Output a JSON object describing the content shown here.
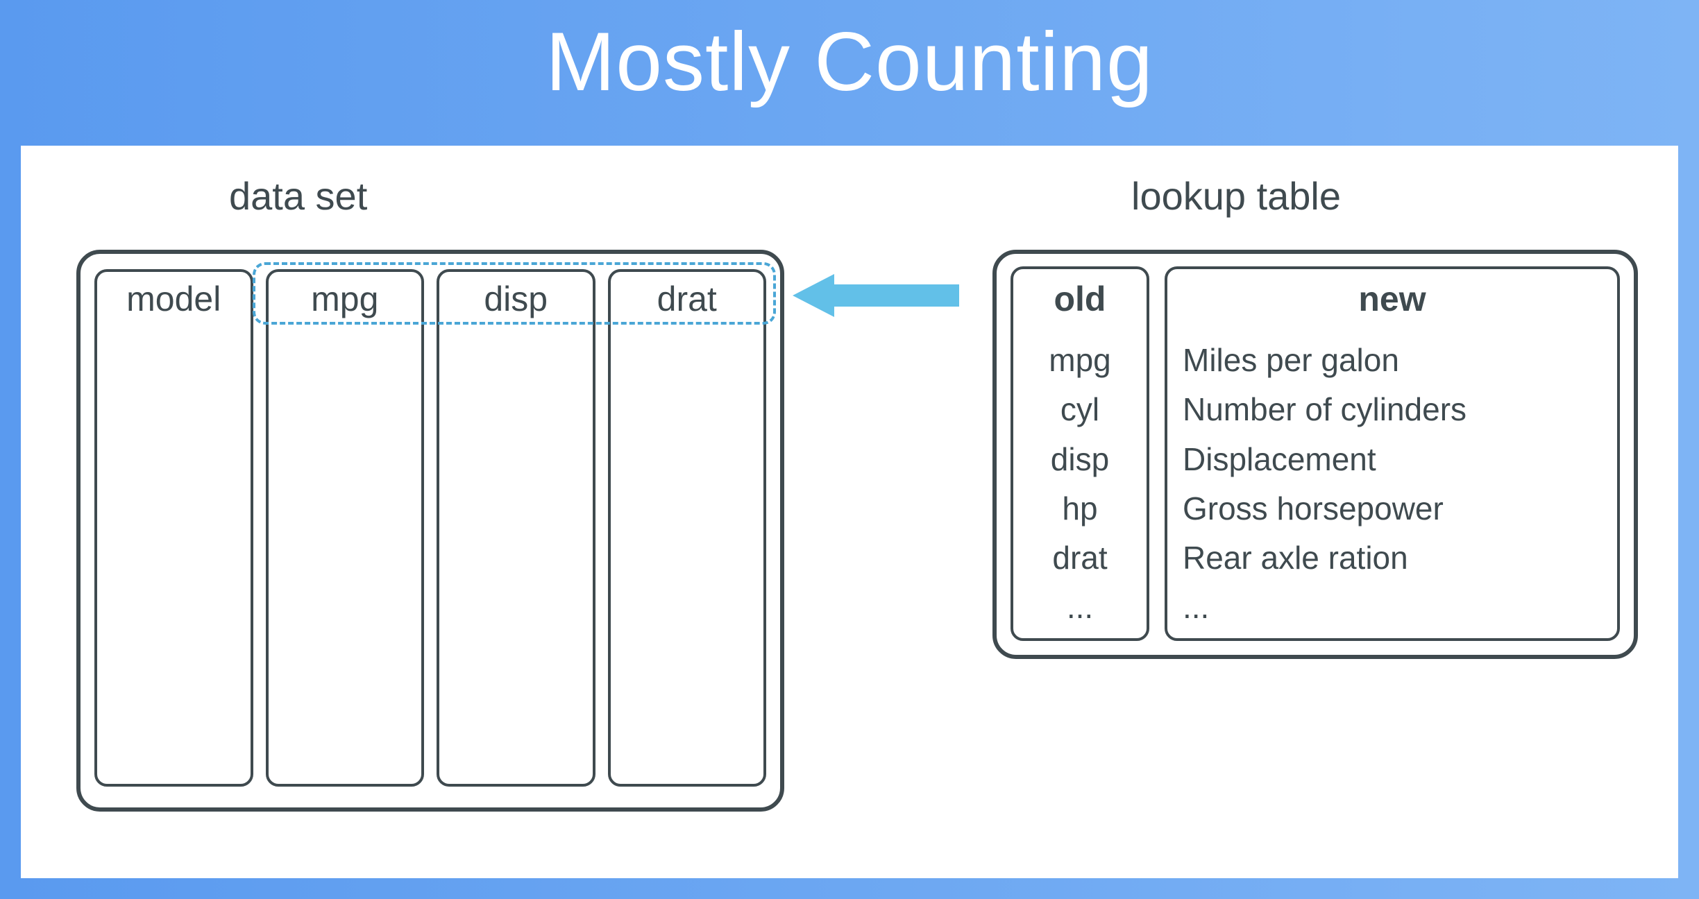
{
  "title": "Mostly Counting",
  "dataset": {
    "label": "data set",
    "columns": [
      "model",
      "mpg",
      "disp",
      "drat"
    ]
  },
  "lookup": {
    "label": "lookup table",
    "old_header": "old",
    "new_header": "new",
    "rows": [
      {
        "old": "mpg",
        "new": "Miles per galon"
      },
      {
        "old": "cyl",
        "new": "Number of cylinders"
      },
      {
        "old": "disp",
        "new": "Displacement"
      },
      {
        "old": "hp",
        "new": "Gross horsepower"
      },
      {
        "old": "drat",
        "new": "Rear axle ration"
      },
      {
        "old": "...",
        "new": "..."
      }
    ]
  }
}
